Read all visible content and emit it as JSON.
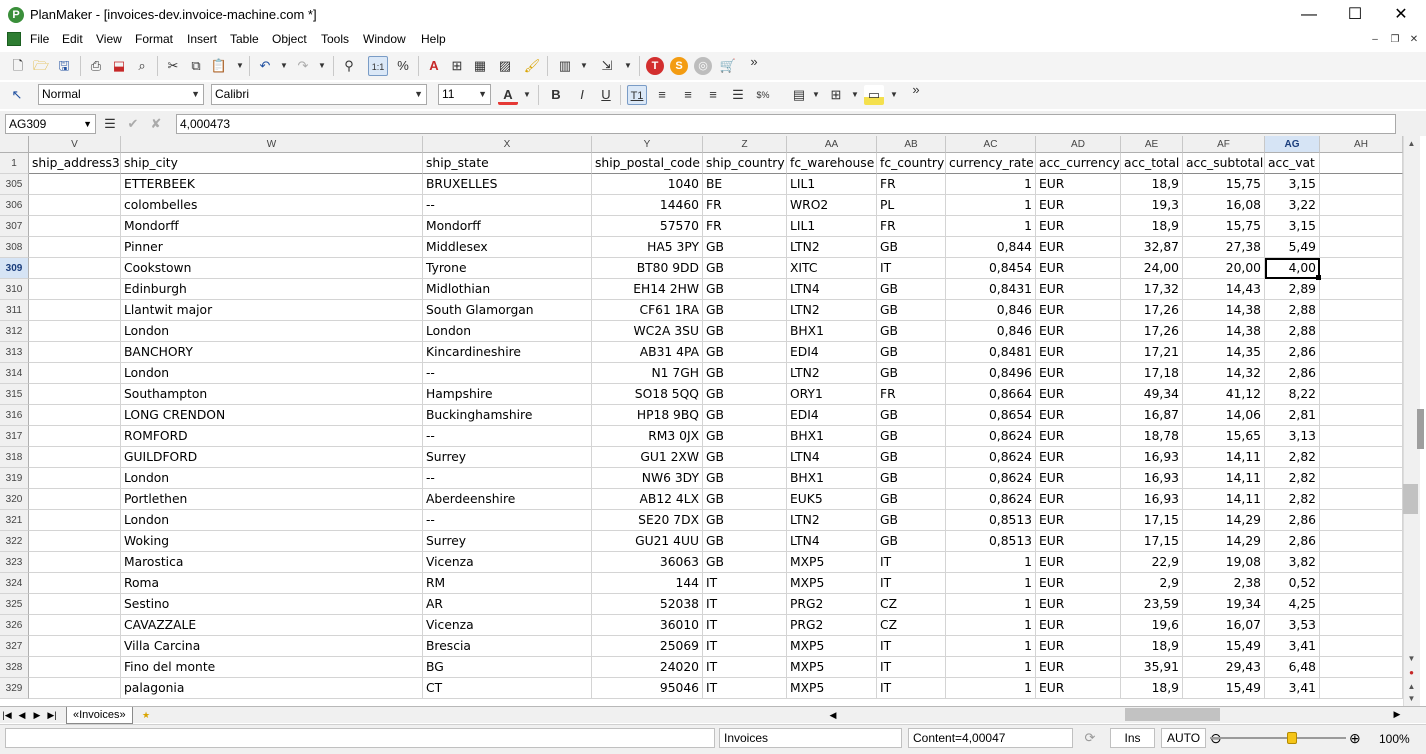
{
  "window": {
    "app_name": "PlanMaker",
    "title": "PlanMaker - [invoices-dev.invoice-machine.com *]",
    "minimize_glyph": "—",
    "maximize_glyph": "☐",
    "close_glyph": "✕"
  },
  "menu": [
    "File",
    "Edit",
    "View",
    "Format",
    "Insert",
    "Table",
    "Object",
    "Tools",
    "Window",
    "Help"
  ],
  "toolbar1": {
    "overflow": "»"
  },
  "toolbar2": {
    "style_value": "Normal",
    "font_value": "Calibri",
    "size_value": "11",
    "overflow": "»"
  },
  "formula_bar": {
    "cell_ref": "AG309",
    "content": "4,000473"
  },
  "columns": [
    {
      "letter": "V",
      "field": "ship_address3",
      "align": "left"
    },
    {
      "letter": "W",
      "field": "ship_city",
      "align": "left"
    },
    {
      "letter": "X",
      "field": "ship_state",
      "align": "left"
    },
    {
      "letter": "Y",
      "field": "ship_postal_code",
      "align": "right"
    },
    {
      "letter": "Z",
      "field": "ship_country",
      "align": "left"
    },
    {
      "letter": "AA",
      "field": "fc_warehouse",
      "align": "left"
    },
    {
      "letter": "AB",
      "field": "fc_country",
      "align": "left"
    },
    {
      "letter": "AC",
      "field": "currency_rate",
      "align": "right"
    },
    {
      "letter": "AD",
      "field": "acc_currency",
      "align": "left"
    },
    {
      "letter": "AE",
      "field": "acc_total",
      "align": "right"
    },
    {
      "letter": "AF",
      "field": "acc_subtotal",
      "align": "right"
    },
    {
      "letter": "AG",
      "field": "acc_vat",
      "align": "right"
    },
    {
      "letter": "AH",
      "field": "",
      "align": "left"
    }
  ],
  "active_column": "AG",
  "active_row": "309",
  "header_row": {
    "num": "1"
  },
  "rows": [
    {
      "num": "305",
      "cells": [
        "",
        "ETTERBEEK",
        "BRUXELLES",
        "1040",
        "BE",
        "LIL1",
        "FR",
        "1",
        "EUR",
        "18,9",
        "15,75",
        "3,15",
        ""
      ]
    },
    {
      "num": "306",
      "cells": [
        "",
        "colombelles",
        "--",
        "14460",
        "FR",
        "WRO2",
        "PL",
        "1",
        "EUR",
        "19,3",
        "16,08",
        "3,22",
        ""
      ]
    },
    {
      "num": "307",
      "cells": [
        "",
        "Mondorff",
        "Mondorff",
        "57570",
        "FR",
        "LIL1",
        "FR",
        "1",
        "EUR",
        "18,9",
        "15,75",
        "3,15",
        ""
      ]
    },
    {
      "num": "308",
      "cells": [
        "",
        "Pinner",
        "Middlesex",
        "HA5 3PY",
        "GB",
        "LTN2",
        "GB",
        "0,844",
        "EUR",
        "32,87",
        "27,38",
        "5,49",
        ""
      ]
    },
    {
      "num": "309",
      "cells": [
        "",
        "Cookstown",
        "Tyrone",
        "BT80 9DD",
        "GB",
        "XITC",
        "IT",
        "0,8454",
        "EUR",
        "24,00",
        "20,00",
        "4,00",
        ""
      ]
    },
    {
      "num": "310",
      "cells": [
        "",
        "Edinburgh",
        "Midlothian",
        "EH14 2HW",
        "GB",
        "LTN4",
        "GB",
        "0,8431",
        "EUR",
        "17,32",
        "14,43",
        "2,89",
        ""
      ]
    },
    {
      "num": "311",
      "cells": [
        "",
        "Llantwit major",
        "South Glamorgan",
        "CF61 1RA",
        "GB",
        "LTN2",
        "GB",
        "0,846",
        "EUR",
        "17,26",
        "14,38",
        "2,88",
        ""
      ]
    },
    {
      "num": "312",
      "cells": [
        "",
        "London",
        "London",
        "WC2A 3SU",
        "GB",
        "BHX1",
        "GB",
        "0,846",
        "EUR",
        "17,26",
        "14,38",
        "2,88",
        ""
      ]
    },
    {
      "num": "313",
      "cells": [
        "",
        "BANCHORY",
        "Kincardineshire",
        "AB31 4PA",
        "GB",
        "EDI4",
        "GB",
        "0,8481",
        "EUR",
        "17,21",
        "14,35",
        "2,86",
        ""
      ]
    },
    {
      "num": "314",
      "cells": [
        "",
        "London",
        "--",
        "N1 7GH",
        "GB",
        "LTN2",
        "GB",
        "0,8496",
        "EUR",
        "17,18",
        "14,32",
        "2,86",
        ""
      ]
    },
    {
      "num": "315",
      "cells": [
        "",
        "Southampton",
        "Hampshire",
        "SO18 5QQ",
        "GB",
        "ORY1",
        "FR",
        "0,8664",
        "EUR",
        "49,34",
        "41,12",
        "8,22",
        ""
      ]
    },
    {
      "num": "316",
      "cells": [
        "",
        "LONG CRENDON",
        "Buckinghamshire",
        "HP18 9BQ",
        "GB",
        "EDI4",
        "GB",
        "0,8654",
        "EUR",
        "16,87",
        "14,06",
        "2,81",
        ""
      ]
    },
    {
      "num": "317",
      "cells": [
        "",
        "ROMFORD",
        "--",
        "RM3 0JX",
        "GB",
        "BHX1",
        "GB",
        "0,8624",
        "EUR",
        "18,78",
        "15,65",
        "3,13",
        ""
      ]
    },
    {
      "num": "318",
      "cells": [
        "",
        "GUILDFORD",
        "Surrey",
        "GU1 2XW",
        "GB",
        "LTN4",
        "GB",
        "0,8624",
        "EUR",
        "16,93",
        "14,11",
        "2,82",
        ""
      ]
    },
    {
      "num": "319",
      "cells": [
        "",
        "London",
        "--",
        "NW6 3DY",
        "GB",
        "BHX1",
        "GB",
        "0,8624",
        "EUR",
        "16,93",
        "14,11",
        "2,82",
        ""
      ]
    },
    {
      "num": "320",
      "cells": [
        "",
        "Portlethen",
        "Aberdeenshire",
        "AB12 4LX",
        "GB",
        "EUK5",
        "GB",
        "0,8624",
        "EUR",
        "16,93",
        "14,11",
        "2,82",
        ""
      ]
    },
    {
      "num": "321",
      "cells": [
        "",
        "London",
        "--",
        "SE20 7DX",
        "GB",
        "LTN2",
        "GB",
        "0,8513",
        "EUR",
        "17,15",
        "14,29",
        "2,86",
        ""
      ]
    },
    {
      "num": "322",
      "cells": [
        "",
        "Woking",
        "Surrey",
        "GU21 4UU",
        "GB",
        "LTN4",
        "GB",
        "0,8513",
        "EUR",
        "17,15",
        "14,29",
        "2,86",
        ""
      ]
    },
    {
      "num": "323",
      "cells": [
        "",
        "Marostica",
        "Vicenza",
        "36063",
        "GB",
        "MXP5",
        "IT",
        "1",
        "EUR",
        "22,9",
        "19,08",
        "3,82",
        ""
      ]
    },
    {
      "num": "324",
      "cells": [
        "",
        "Roma",
        "RM",
        "144",
        "IT",
        "MXP5",
        "IT",
        "1",
        "EUR",
        "2,9",
        "2,38",
        "0,52",
        ""
      ]
    },
    {
      "num": "325",
      "cells": [
        "",
        "Sestino",
        "AR",
        "52038",
        "IT",
        "PRG2",
        "CZ",
        "1",
        "EUR",
        "23,59",
        "19,34",
        "4,25",
        ""
      ]
    },
    {
      "num": "326",
      "cells": [
        "",
        "CAVAZZALE",
        "Vicenza",
        "36010",
        "IT",
        "PRG2",
        "CZ",
        "1",
        "EUR",
        "19,6",
        "16,07",
        "3,53",
        ""
      ]
    },
    {
      "num": "327",
      "cells": [
        "",
        "Villa Carcina",
        "Brescia",
        "25069",
        "IT",
        "MXP5",
        "IT",
        "1",
        "EUR",
        "18,9",
        "15,49",
        "3,41",
        ""
      ]
    },
    {
      "num": "328",
      "cells": [
        "",
        "Fino del monte",
        "BG",
        "24020",
        "IT",
        "MXP5",
        "IT",
        "1",
        "EUR",
        "35,91",
        "29,43",
        "6,48",
        ""
      ]
    },
    {
      "num": "329",
      "cells": [
        "",
        "palagonia",
        "CT",
        "95046",
        "IT",
        "MXP5",
        "IT",
        "1",
        "EUR",
        "18,9",
        "15,49",
        "3,41",
        ""
      ]
    }
  ],
  "sheet_tabs": [
    {
      "label": "«Invoices»",
      "active": true
    }
  ],
  "status": {
    "sheet_name": "Invoices",
    "content": "Content=4,00047",
    "ins": "Ins",
    "mode": "AUTO",
    "zoom": "100%"
  },
  "colors": {
    "active_header_bg": "#d6e4f5",
    "grid_line": "#d4d4d4",
    "header_bg": "#f0f0f0"
  }
}
